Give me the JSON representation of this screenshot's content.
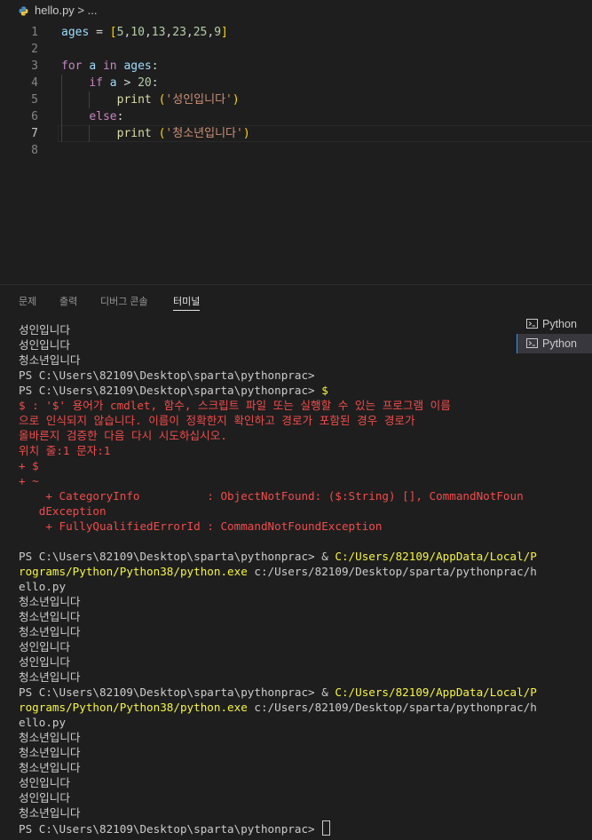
{
  "breadcrumb": {
    "file": "hello.py",
    "tail": " > ..."
  },
  "editor": {
    "line_numbers": [
      "1",
      "2",
      "3",
      "4",
      "5",
      "6",
      "7",
      "8"
    ],
    "active_line": "7",
    "lines": [
      {
        "parts": [
          {
            "t": "ages",
            "c": "var"
          },
          {
            "t": " = ",
            "c": "op"
          },
          {
            "t": "[",
            "c": "brk"
          },
          {
            "t": "5",
            "c": "num"
          },
          {
            "t": ",",
            "c": "op"
          },
          {
            "t": "10",
            "c": "num"
          },
          {
            "t": ",",
            "c": "op"
          },
          {
            "t": "13",
            "c": "num"
          },
          {
            "t": ",",
            "c": "op"
          },
          {
            "t": "23",
            "c": "num"
          },
          {
            "t": ",",
            "c": "op"
          },
          {
            "t": "25",
            "c": "num"
          },
          {
            "t": ",",
            "c": "op"
          },
          {
            "t": "9",
            "c": "num"
          },
          {
            "t": "]",
            "c": "brk"
          }
        ]
      },
      {
        "parts": []
      },
      {
        "parts": [
          {
            "t": "for",
            "c": "kw"
          },
          {
            "t": " ",
            "c": "op"
          },
          {
            "t": "a",
            "c": "var"
          },
          {
            "t": " ",
            "c": "op"
          },
          {
            "t": "in",
            "c": "kw"
          },
          {
            "t": " ",
            "c": "op"
          },
          {
            "t": "ages",
            "c": "var"
          },
          {
            "t": ":",
            "c": "op"
          }
        ]
      },
      {
        "parts": [
          {
            "t": "    ",
            "c": "op"
          },
          {
            "t": "if",
            "c": "kw"
          },
          {
            "t": " ",
            "c": "op"
          },
          {
            "t": "a",
            "c": "var"
          },
          {
            "t": " > ",
            "c": "op"
          },
          {
            "t": "20",
            "c": "num"
          },
          {
            "t": ":",
            "c": "op"
          }
        ]
      },
      {
        "parts": [
          {
            "t": "        ",
            "c": "op"
          },
          {
            "t": "print",
            "c": "fn"
          },
          {
            "t": " ",
            "c": "op"
          },
          {
            "t": "(",
            "c": "brk"
          },
          {
            "t": "'성인입니다'",
            "c": "str"
          },
          {
            "t": ")",
            "c": "brk"
          }
        ]
      },
      {
        "parts": [
          {
            "t": "    ",
            "c": "op"
          },
          {
            "t": "else",
            "c": "kw"
          },
          {
            "t": ":",
            "c": "op"
          }
        ]
      },
      {
        "parts": [
          {
            "t": "        ",
            "c": "op"
          },
          {
            "t": "print",
            "c": "fn"
          },
          {
            "t": " ",
            "c": "op"
          },
          {
            "t": "(",
            "c": "brk"
          },
          {
            "t": "'청소년입니다'",
            "c": "str"
          },
          {
            "t": ")",
            "c": "brk"
          }
        ]
      },
      {
        "parts": []
      }
    ]
  },
  "panel": {
    "tabs": [
      {
        "label": "문제",
        "active": false
      },
      {
        "label": "출력",
        "active": false
      },
      {
        "label": "디버그 콘솔",
        "active": false
      },
      {
        "label": "터미널",
        "active": true
      }
    ],
    "terminal_list": [
      {
        "label": "Python",
        "selected": false
      },
      {
        "label": "Python",
        "selected": true
      }
    ]
  },
  "terminal": {
    "lines": [
      [
        {
          "t": "성인입니다",
          "c": ""
        }
      ],
      [
        {
          "t": "성인입니다",
          "c": ""
        }
      ],
      [
        {
          "t": "청소년입니다",
          "c": ""
        }
      ],
      [
        {
          "t": "PS C:\\Users\\82109\\Desktop\\sparta\\pythonprac>",
          "c": ""
        }
      ],
      [
        {
          "t": "PS C:\\Users\\82109\\Desktop\\sparta\\pythonprac> ",
          "c": ""
        },
        {
          "t": "$",
          "c": "yel"
        }
      ],
      [
        {
          "t": "$ : '$' 용어가 cmdlet, 함수, 스크립트 파일 또는 실행할 수 있는 프로그램 이름",
          "c": "red"
        }
      ],
      [
        {
          "t": "으로 인식되지 않습니다. 이름이 정확한지 확인하고 경로가 포함된 경우 경로가",
          "c": "red"
        }
      ],
      [
        {
          "t": "올바른지 검증한 다음 다시 시도하십시오.",
          "c": "red"
        }
      ],
      [
        {
          "t": "위치 줄:1 문자:1",
          "c": "red"
        }
      ],
      [
        {
          "t": "+ $",
          "c": "red"
        }
      ],
      [
        {
          "t": "+ ~",
          "c": "red"
        }
      ],
      [
        {
          "t": "    + CategoryInfo          : ObjectNotFound: ($:String) [], CommandNotFoun",
          "c": "red"
        }
      ],
      [
        {
          "t": "   dException",
          "c": "red"
        }
      ],
      [
        {
          "t": "    + FullyQualifiedErrorId : CommandNotFoundException",
          "c": "red"
        }
      ],
      [
        {
          "t": "",
          "c": ""
        }
      ],
      [
        {
          "t": "PS C:\\Users\\82109\\Desktop\\sparta\\pythonprac> & ",
          "c": ""
        },
        {
          "t": "C:/Users/82109/AppData/Local/P",
          "c": "yel"
        }
      ],
      [
        {
          "t": "rograms/Python/Python38/python.exe",
          "c": "yel"
        },
        {
          "t": " c:/Users/82109/Desktop/sparta/pythonprac/h",
          "c": ""
        }
      ],
      [
        {
          "t": "ello.py",
          "c": ""
        }
      ],
      [
        {
          "t": "청소년입니다",
          "c": ""
        }
      ],
      [
        {
          "t": "청소년입니다",
          "c": ""
        }
      ],
      [
        {
          "t": "청소년입니다",
          "c": ""
        }
      ],
      [
        {
          "t": "성인입니다",
          "c": ""
        }
      ],
      [
        {
          "t": "성인입니다",
          "c": ""
        }
      ],
      [
        {
          "t": "청소년입니다",
          "c": ""
        }
      ],
      [
        {
          "t": "PS C:\\Users\\82109\\Desktop\\sparta\\pythonprac> & ",
          "c": ""
        },
        {
          "t": "C:/Users/82109/AppData/Local/P",
          "c": "yel"
        }
      ],
      [
        {
          "t": "rograms/Python/Python38/python.exe",
          "c": "yel"
        },
        {
          "t": " c:/Users/82109/Desktop/sparta/pythonprac/h",
          "c": ""
        }
      ],
      [
        {
          "t": "ello.py",
          "c": ""
        }
      ],
      [
        {
          "t": "청소년입니다",
          "c": ""
        }
      ],
      [
        {
          "t": "청소년입니다",
          "c": ""
        }
      ],
      [
        {
          "t": "청소년입니다",
          "c": ""
        }
      ],
      [
        {
          "t": "성인입니다",
          "c": ""
        }
      ],
      [
        {
          "t": "성인입니다",
          "c": ""
        }
      ],
      [
        {
          "t": "청소년입니다",
          "c": ""
        }
      ],
      [
        {
          "t": "PS C:\\Users\\82109\\Desktop\\sparta\\pythonprac> ",
          "c": "",
          "cursor": true
        }
      ]
    ]
  },
  "colors": {
    "background": "#1e1e1e",
    "error_text": "#f14c4c",
    "command_highlight": "#f5f543",
    "keyword": "#c586c0",
    "string": "#ce9178"
  },
  "icons": {
    "file": "python-file-icon",
    "terminal": "terminal-icon"
  }
}
